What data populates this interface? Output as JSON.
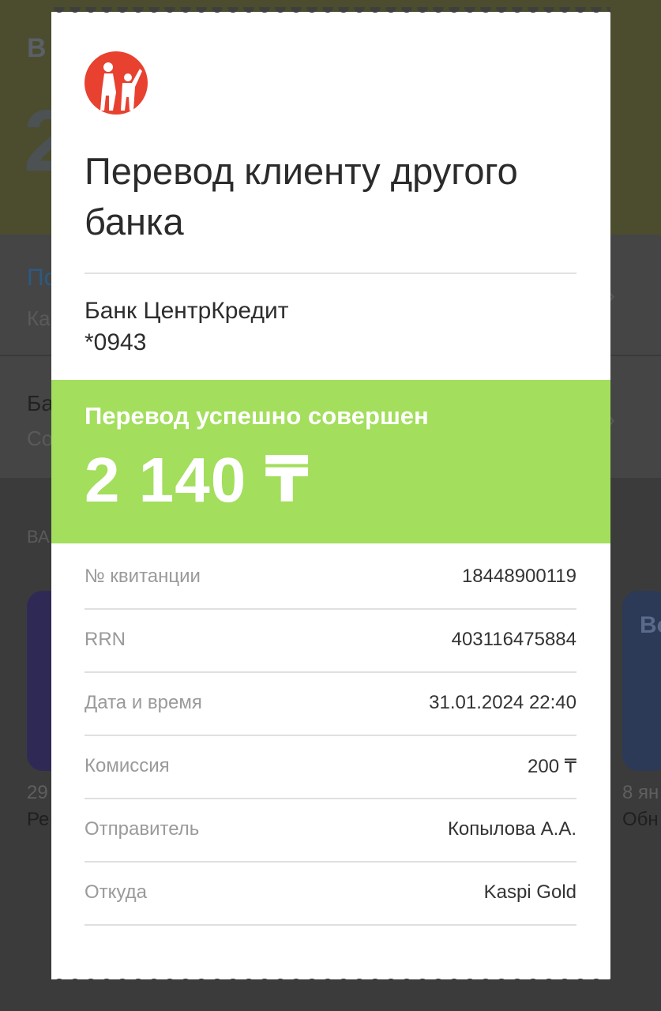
{
  "receipt": {
    "title": "Перевод клиенту другого банка",
    "bank_name": "Банк ЦентрКредит",
    "account": "*0943",
    "status": "Перевод успешно совершен",
    "amount": "2 140 ₸",
    "details": [
      {
        "label": "№ квитанции",
        "value": "18448900119"
      },
      {
        "label": "RRN",
        "value": "403116475884"
      },
      {
        "label": "Дата и время",
        "value": "31.01.2024 22:40"
      },
      {
        "label": "Комиссия",
        "value": "200 ₸"
      },
      {
        "label": "Отправитель",
        "value": "Копылова А.А."
      },
      {
        "label": "Откуда",
        "value": "Kaspi Gold"
      }
    ],
    "colors": {
      "success": "#a3de5c",
      "logo": "#e8412f"
    },
    "logo_icon": "bank-logo-icon"
  },
  "background": {
    "fragments": [
      "В",
      "2",
      "По",
      "Ка",
      "Ба",
      "Со",
      "ВА",
      "29",
      "Ре",
      "8 ян",
      "Обн",
      "Во"
    ]
  }
}
